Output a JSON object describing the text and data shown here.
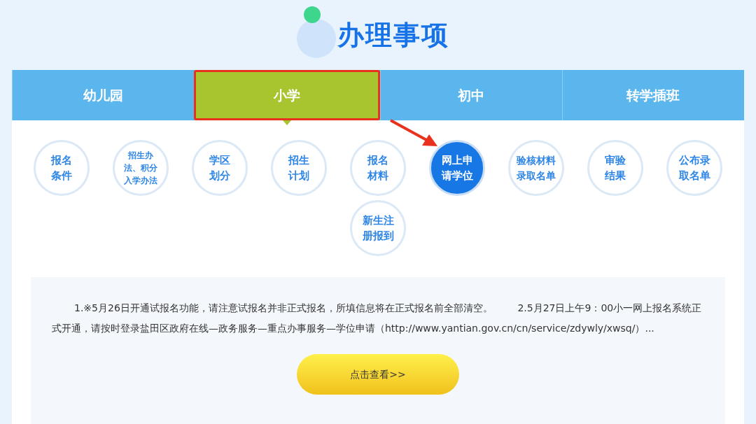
{
  "title": "办理事项",
  "tabs": [
    {
      "label": "幼儿园",
      "selected": false
    },
    {
      "label": "小学",
      "selected": true
    },
    {
      "label": "初中",
      "selected": false
    },
    {
      "label": "转学插班",
      "selected": false
    }
  ],
  "items": [
    {
      "label": "报名条件",
      "selected": false
    },
    {
      "label": "招生办法、积分入学办法",
      "selected": false
    },
    {
      "label": "学区划分",
      "selected": false
    },
    {
      "label": "招生计划",
      "selected": false
    },
    {
      "label": "报名材料",
      "selected": false
    },
    {
      "label": "网上申请学位",
      "selected": true
    },
    {
      "label": "验核材料录取名单",
      "selected": false
    },
    {
      "label": "审验结果",
      "selected": false
    },
    {
      "label": "公布录取名单",
      "selected": false
    },
    {
      "label": "新生注册报到",
      "selected": false
    }
  ],
  "notice": "1.※5月26日开通试报名功能，请注意试报名并非正式报名，所填信息将在正式报名前全部清空。        2.5月27日上午9：00小一网上报名系统正式开通，请按时登录盐田区政府在线—政务服务—重点办事服务—学位申请（http://www.yantian.gov.cn/cn/service/zdywly/xwsq/）...",
  "button": "点击查看>>"
}
